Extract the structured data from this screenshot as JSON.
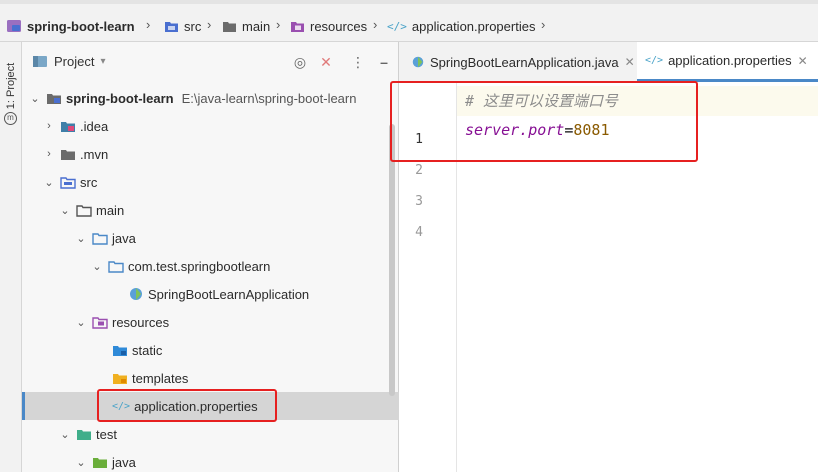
{
  "breadcrumb": {
    "project": "spring-boot-learn",
    "items": [
      "src",
      "main",
      "resources",
      "application.properties"
    ]
  },
  "toolstrip": {
    "project_label": "1: Project"
  },
  "project_panel": {
    "title": "Project",
    "tree": [
      {
        "label": "spring-boot-learn",
        "path": "E:\\java-learn\\spring-boot-learn",
        "icon": "module-folder-icon",
        "arrow": "down"
      },
      {
        "label": ".idea",
        "icon": "idea-folder-icon",
        "arrow": "right"
      },
      {
        "label": ".mvn",
        "icon": "folder-icon",
        "arrow": "right"
      },
      {
        "label": "src",
        "icon": "source-folder-icon",
        "arrow": "down"
      },
      {
        "label": "main",
        "icon": "folder-icon",
        "arrow": "down"
      },
      {
        "label": "java",
        "icon": "java-source-folder-icon",
        "arrow": "down"
      },
      {
        "label": "com.test.springbootlearn",
        "icon": "package-icon",
        "arrow": "down"
      },
      {
        "label": "SpringBootLearnApplication",
        "icon": "spring-boot-class-icon",
        "arrow": "none"
      },
      {
        "label": "resources",
        "icon": "resources-folder-icon",
        "arrow": "down"
      },
      {
        "label": "static",
        "icon": "blue-folder-icon",
        "arrow": "none"
      },
      {
        "label": "templates",
        "icon": "yellow-folder-icon",
        "arrow": "none"
      },
      {
        "label": "application.properties",
        "icon": "properties-file-icon",
        "arrow": "none"
      },
      {
        "label": "test",
        "icon": "test-folder-icon",
        "arrow": "down"
      },
      {
        "label": "java",
        "icon": "test-java-folder-icon",
        "arrow": "down"
      }
    ]
  },
  "editor": {
    "tabs": [
      {
        "label": "SpringBootLearnApplication.java",
        "active": false
      },
      {
        "label": "application.properties",
        "active": true
      }
    ],
    "line_numbers": [
      "1",
      "2",
      "3",
      "4"
    ],
    "lines": {
      "comment": "# 这里可以设置端口号",
      "key": "server.port",
      "eq": "=",
      "value": "8081"
    }
  },
  "colors": {
    "highlight_box": "#e62020",
    "active_tab_underline": "#4a88c7",
    "selected_row": "#d5d5d5"
  }
}
